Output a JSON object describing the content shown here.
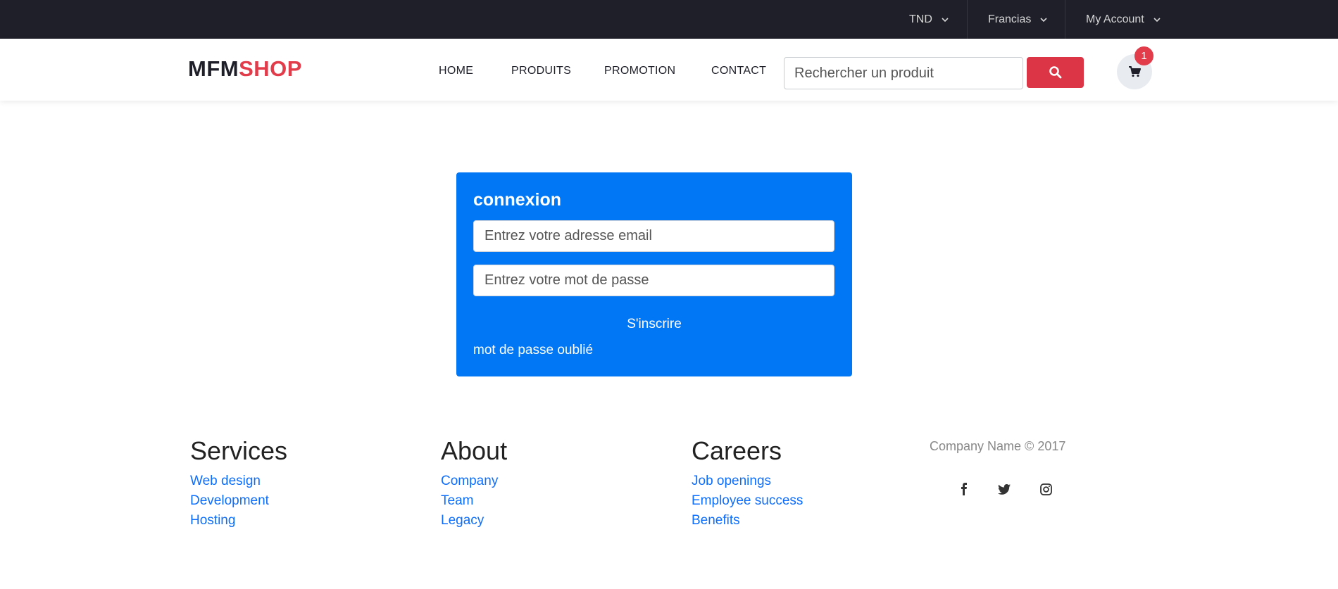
{
  "topbar": {
    "currency": "TND",
    "language": "Francias",
    "account": "My Account"
  },
  "header": {
    "logo_part1": "MFM",
    "logo_part2": "SHOP",
    "nav": [
      "HOME",
      "PRODUITS",
      "PROMOTION",
      "CONTACT"
    ],
    "search_placeholder": "Rechercher un produit",
    "cart_count": "1"
  },
  "login": {
    "title": "connexion",
    "email_placeholder": "Entrez votre adresse email",
    "password_placeholder": "Entrez votre mot de passe",
    "signup_label": "S'inscrire",
    "forgot_label": "mot de passe oublié"
  },
  "footer": {
    "columns": [
      {
        "title": "Services",
        "links": [
          "Web design",
          "Development",
          "Hosting"
        ]
      },
      {
        "title": "About",
        "links": [
          "Company",
          "Team",
          "Legacy"
        ]
      },
      {
        "title": "Careers",
        "links": [
          "Job openings",
          "Employee success",
          "Benefits"
        ]
      }
    ],
    "copyright": "Company Name © 2017",
    "social_icons": [
      "facebook-icon",
      "twitter-icon",
      "instagram-icon"
    ]
  },
  "colors": {
    "topbar_bg": "#1e1f29",
    "brand_red": "#e23b4a",
    "card_blue": "#0277f6",
    "link_blue": "#0d6efd",
    "search_button": "#dc3545"
  }
}
